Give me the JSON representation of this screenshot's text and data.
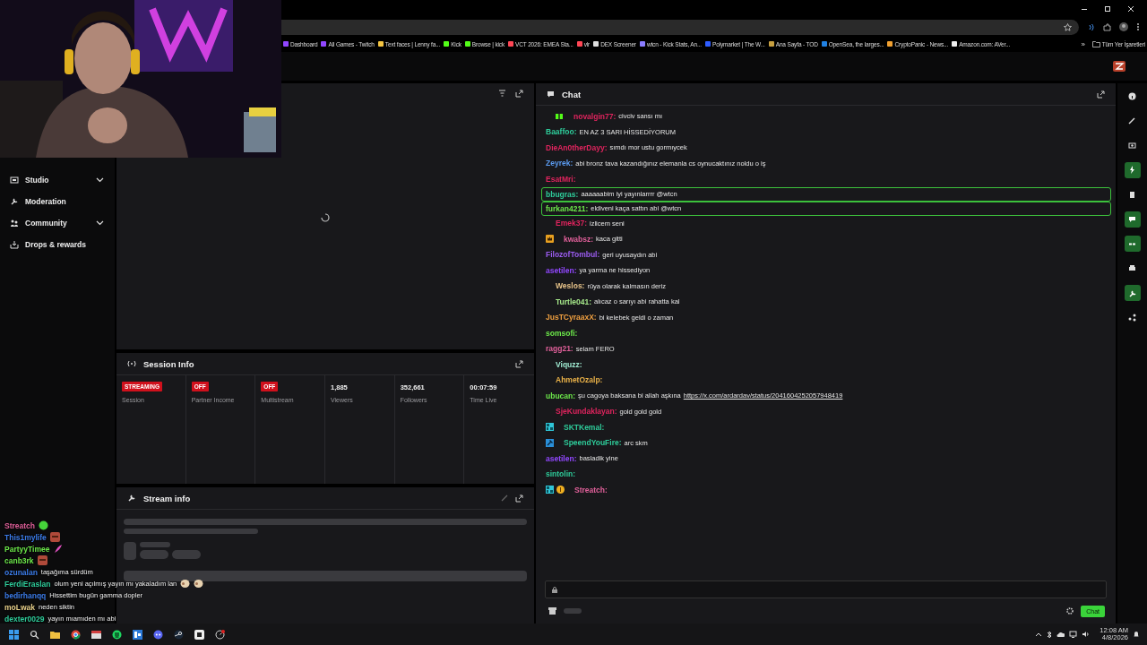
{
  "browser": {
    "bookmarks": [
      {
        "label": "Dashboard",
        "color": "#9146ff"
      },
      {
        "label": "All Games - Twitch",
        "color": "#9146ff"
      },
      {
        "label": "Text faces | Lenny fa...",
        "color": "#f5c542"
      },
      {
        "label": "Kick",
        "color": "#53fc18"
      },
      {
        "label": "Browse | kick",
        "color": "#53fc18"
      },
      {
        "label": "VCT 2026: EMEA Sta...",
        "color": "#ff4655"
      },
      {
        "label": "vlr",
        "color": "#ff4655"
      },
      {
        "label": "DEX Screener",
        "color": "#dddddd"
      },
      {
        "label": "wtcn - Kick Stats, An...",
        "color": "#8a7cff"
      },
      {
        "label": "Polymarket | The W...",
        "color": "#2e5cff"
      },
      {
        "label": "Ana Sayfa - TOD",
        "color": "#c8a040"
      },
      {
        "label": "OpenSea, the larges...",
        "color": "#2081e2"
      },
      {
        "label": "CryptoPanic - News...",
        "color": "#f0a030"
      },
      {
        "label": "Amazon.com: AVer...",
        "color": "#eeeeee"
      }
    ],
    "more": "»",
    "all_bookmarks": "Tüm Yer İşaretleri"
  },
  "sidebar": {
    "items": [
      {
        "label": "Studio",
        "expandable": true
      },
      {
        "label": "Moderation",
        "expandable": false
      },
      {
        "label": "Community",
        "expandable": true
      },
      {
        "label": "Drops & rewards",
        "expandable": false
      }
    ]
  },
  "session_info": {
    "title": "Session Info",
    "stats": [
      {
        "kind": "status",
        "badge": "STREAMING",
        "label": "Session"
      },
      {
        "kind": "status",
        "badge": "OFF",
        "label": "Partner Income"
      },
      {
        "kind": "status",
        "badge": "OFF",
        "label": "Multistream"
      },
      {
        "kind": "stat",
        "value": "1,885",
        "label": "Viewers"
      },
      {
        "kind": "stat",
        "value": "352,661",
        "label": "Followers"
      },
      {
        "kind": "stat",
        "value": "00:07:59",
        "label": "Time Live"
      }
    ]
  },
  "stream_info": {
    "title": "Stream info"
  },
  "chat": {
    "title": "Chat",
    "messages": [
      {
        "user": "novalgin77:",
        "color": "#e0245e",
        "text": "civciv sansı mı",
        "indented": true,
        "highlighted": false,
        "badges": [
          {
            "kind": "gift"
          }
        ]
      },
      {
        "user": "Baaffoo:",
        "color": "#2ecc9a",
        "text": "EN AZ 3 SARI HİSSEDİYORUM",
        "indented": false,
        "highlighted": false
      },
      {
        "user": "DieAn0therDayy:",
        "color": "#e0245e",
        "text": "sımdı mor ustu gormıycek",
        "indented": false,
        "highlighted": false
      },
      {
        "user": "Zeyrek:",
        "color": "#5b9bf0",
        "text": "abi bronz tava kazandığınız elemanla cs oynucaktınız noldu o iş",
        "indented": false,
        "highlighted": false
      },
      {
        "user": "EsatMri:",
        "color": "#e0245e",
        "indented": false,
        "highlighted": false
      },
      {
        "user": "bbugras:",
        "color": "#2ecc9a",
        "text": "aaaaaabim iyi yayınlarrrr @wtcn",
        "indented": false,
        "highlighted": true
      },
      {
        "user": "furkan4211:",
        "color": "#6ce84a",
        "text": "eldiveni kaça sattın abi @wtcn",
        "indented": false,
        "highlighted": true
      },
      {
        "user": "Emek37:",
        "color": "#e0245e",
        "text": "izlicem seni",
        "indented": true,
        "highlighted": false
      },
      {
        "user": "kwabsz:",
        "color": "#e0609a",
        "text": "kaca gitti",
        "indented": false,
        "highlighted": false,
        "badges": [
          {
            "kind": "crown"
          }
        ]
      },
      {
        "user": "FilozofTombul:",
        "color": "#9b5cf0",
        "text": "geri uyusaydın abi",
        "indented": false,
        "highlighted": false
      },
      {
        "user": "asetilen:",
        "color": "#9147ff",
        "text": "ya yarma ne hissediyon",
        "indented": false,
        "highlighted": false
      },
      {
        "user": "Weslos:",
        "color": "#e8c48a",
        "text": "rüya olarak kalmasın deriz",
        "indented": true,
        "highlighted": false
      },
      {
        "user": "Turtle041:",
        "color": "#a6e88a",
        "text": "alıcaz o sarıyı abi rahatta kal",
        "indented": true,
        "highlighted": false
      },
      {
        "user": "JusTCyraaxX:",
        "color": "#f0a040",
        "text": "bi kelebek geldi o zaman",
        "indented": false,
        "highlighted": false
      },
      {
        "user": "somsofi:",
        "color": "#6ce84a",
        "indented": false,
        "highlighted": false
      },
      {
        "user": "ragg21:",
        "color": "#e0609a",
        "text": "selam FERO",
        "indented": false,
        "highlighted": false
      },
      {
        "user": "Viquzz:",
        "color": "#9ee8d0",
        "indented": true,
        "highlighted": false
      },
      {
        "user": "AhmetOzalp:",
        "color": "#e8b048",
        "indented": true,
        "highlighted": false
      },
      {
        "user": "ubucan:",
        "color": "#6ce84a",
        "text": "şu cagoya baksana bi allah aşkına",
        "link": "https://x.com/ardardav/status/2041604252057948419",
        "indented": false,
        "highlighted": false
      },
      {
        "user": "SjeKundaklayan:",
        "color": "#e0245e",
        "text": "gold gold gold",
        "indented": true,
        "highlighted": false
      },
      {
        "user": "SKTKemal:",
        "color": "#2ecc9a",
        "indented": false,
        "highlighted": false,
        "badges": [
          {
            "kind": "grid"
          }
        ]
      },
      {
        "user": "SpeendYouFire:",
        "color": "#2ecc9a",
        "text": "arc skm",
        "indented": false,
        "highlighted": false,
        "badges": [
          {
            "kind": "hammer"
          }
        ]
      },
      {
        "user": "asetilen:",
        "color": "#9147ff",
        "text": "basladik yine",
        "indented": false,
        "highlighted": false
      },
      {
        "user": "sintolin:",
        "color": "#2ecc9a",
        "indented": false,
        "highlighted": false
      },
      {
        "user": "Streatch:",
        "color": "#e0609a",
        "indented": false,
        "highlighted": false,
        "badges": [
          {
            "kind": "grid"
          },
          {
            "kind": "coin"
          }
        ]
      }
    ],
    "send_button": "Chat"
  },
  "rail_buttons": [
    {
      "active": false
    },
    {
      "active": false
    },
    {
      "active": false
    },
    {
      "active": true
    },
    {
      "active": false
    },
    {
      "active": true
    },
    {
      "active": true
    },
    {
      "active": false
    },
    {
      "active": true
    },
    {
      "active": false
    }
  ],
  "overlay_chat": [
    {
      "user": "Streatch",
      "color": "#e0609a",
      "emotes": [
        {
          "kind": "blob"
        }
      ]
    },
    {
      "user": "This1mylife",
      "color": "#3b7be8",
      "emotes": [
        {
          "kind": "face"
        }
      ]
    },
    {
      "user": "PartyyTimee",
      "color": "#6ce84a",
      "emotes": [
        {
          "kind": "feather"
        }
      ]
    },
    {
      "user": "canb3rk",
      "color": "#6ce84a",
      "emotes": [
        {
          "kind": "face"
        }
      ]
    },
    {
      "user": "ozunalan",
      "color": "#3b7be8",
      "text": "taşağıma sürdüm"
    },
    {
      "user": "FerdiEraslan",
      "color": "#2ecc9a",
      "text": "olum yeni açılmış yayın mı yakaladım lan",
      "emotes": [
        {
          "kind": "sheep"
        },
        {
          "kind": "sheep"
        }
      ]
    },
    {
      "user": "bedirhanqq",
      "color": "#3b7be8",
      "text": "Hissettim bugün gamma dopler"
    },
    {
      "user": "moLwak",
      "color": "#e8d08a",
      "text": "neden siktin"
    },
    {
      "user": "dexter0029",
      "color": "#2ecc9a",
      "text": "yayın mıamıden mı abi"
    }
  ],
  "taskbar": {
    "time": "12:08 AM",
    "date": "4/8/2026"
  }
}
